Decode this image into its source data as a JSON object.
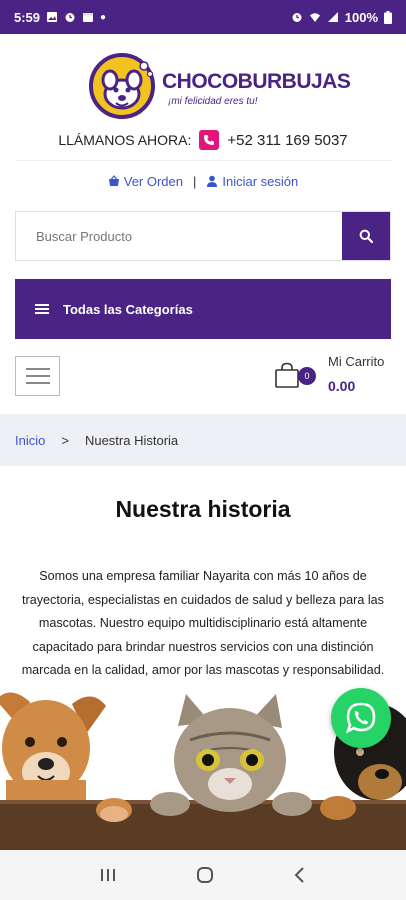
{
  "status_bar": {
    "time": "5:59",
    "battery": "100%"
  },
  "brand": {
    "name": "CHOCOBURBUJAS",
    "tagline": "¡mi felicidad eres tu!",
    "color": "#4a2385",
    "accent": "#f2c21f"
  },
  "contact": {
    "label": "LLÁMANOS AHORA:",
    "phone": "+52 311 169 5037"
  },
  "account_links": {
    "orders": "Ver Orden",
    "separator": "|",
    "login": "Iniciar sesión"
  },
  "search": {
    "placeholder": "Buscar Producto"
  },
  "categories": {
    "label": "Todas las Categorías"
  },
  "cart": {
    "count": "0",
    "label": "Mi Carrito",
    "total": "0.00"
  },
  "breadcrumb": {
    "home": "Inicio",
    "separator": ">",
    "current": "Nuestra Historia"
  },
  "page": {
    "title": "Nuestra historia",
    "body": "Somos una empresa familiar Nayarita con más 10 años de trayectoria, especialistas en cuidados de salud y belleza para las mascotas. Nuestro equipo multidisciplinario está altamente capacitado para brindar nuestros servicios con una distinción marcada en la calidad, amor por las mascotas y responsabilidad."
  },
  "icons": {
    "whatsapp": "whatsapp-icon",
    "search": "search-icon",
    "cart": "shopping-bag-icon",
    "menu": "hamburger-icon"
  }
}
